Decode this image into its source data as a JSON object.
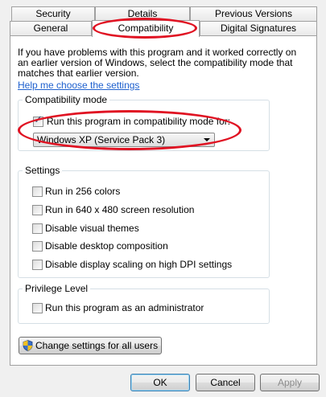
{
  "tabs": {
    "security": "Security",
    "details": "Details",
    "previous_versions": "Previous Versions",
    "general": "General",
    "compatibility": "Compatibility",
    "digital_signatures": "Digital Signatures"
  },
  "intro": {
    "line1": "If you have problems with this program and it worked correctly on",
    "line2": "an earlier version of Windows, select the compatibility mode that",
    "line3": "matches that earlier version.",
    "help_link": "Help me choose the settings"
  },
  "compat_mode": {
    "title": "Compatibility mode",
    "checkbox_label": "Run this program in compatibility mode for:",
    "checked": true,
    "selected_os": "Windows XP (Service Pack 3)"
  },
  "settings": {
    "title": "Settings",
    "options": [
      {
        "label": "Run in 256 colors",
        "checked": false
      },
      {
        "label": "Run in 640 x 480 screen resolution",
        "checked": false
      },
      {
        "label": "Disable visual themes",
        "checked": false
      },
      {
        "label": "Disable desktop composition",
        "checked": false
      },
      {
        "label": "Disable display scaling on high DPI settings",
        "checked": false
      }
    ]
  },
  "privilege": {
    "title": "Privilege Level",
    "admin_label": "Run this program as an administrator",
    "checked": false
  },
  "change_all_users": "Change settings for all users",
  "buttons": {
    "ok": "OK",
    "cancel": "Cancel",
    "apply": "Apply"
  },
  "colors": {
    "highlight_ellipse": "#e01222",
    "link": "#1e60ce"
  }
}
